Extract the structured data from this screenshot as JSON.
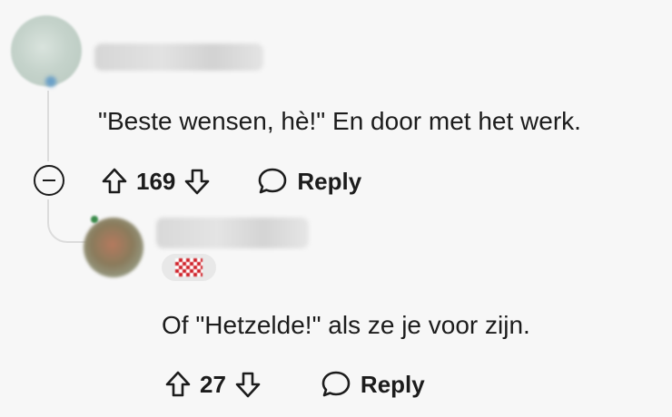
{
  "comment": {
    "body": "\"Beste wensen, hè!\" En door met het werk.",
    "upvotes": "169",
    "reply_label": "Reply"
  },
  "reply": {
    "body": "Of \"Hetzelde!\" als ze je voor zijn.",
    "upvotes": "27",
    "reply_label": "Reply"
  },
  "colors": {
    "background": "#f7f7f7",
    "text": "#1c1c1c",
    "thread_line": "#dcdcdc",
    "flair_red": "#d0222a"
  },
  "icons": {
    "upvote": "arrow-up-icon",
    "downvote": "arrow-down-icon",
    "reply": "speech-bubble-icon",
    "collapse": "minus-circle-icon"
  }
}
